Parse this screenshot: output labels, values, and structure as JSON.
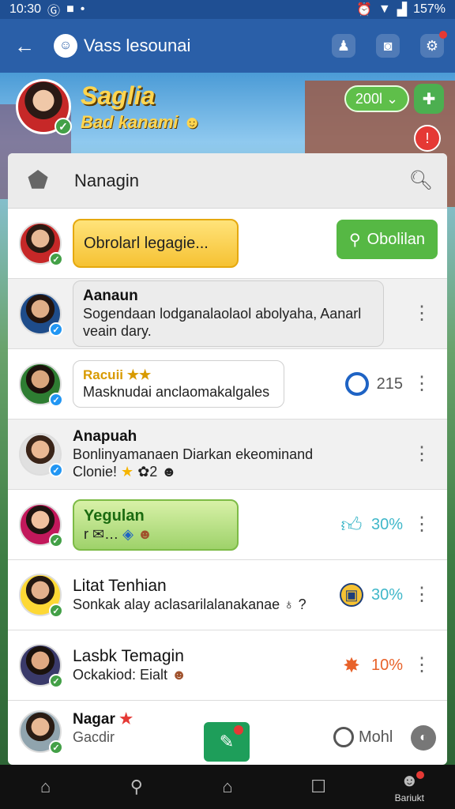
{
  "status": {
    "time": "10:30",
    "battery": "157%"
  },
  "appbar": {
    "title": "Vass lesounai",
    "back_icon": "arrow-left-icon",
    "actions": [
      "user-add-icon",
      "camera-icon",
      "settings-icon"
    ]
  },
  "profile": {
    "name_line1": "Saglia",
    "name_line2": "Bad kanami",
    "coins": "200l",
    "verified": true
  },
  "panel": {
    "title": "Nanagin",
    "search_icon": "search-icon"
  },
  "rows": [
    {
      "bubble": "Obrolarl legagie...",
      "button": "Obolilan"
    },
    {
      "name": "Aanaun",
      "message": "Sogendaan lodganalaolaol abolyaha, Aanarl veain dary."
    },
    {
      "name": "Racuii",
      "stars": "★★",
      "message": "Masknudai anclaomakalgales",
      "stat": "215"
    },
    {
      "name": "Anapuah",
      "message_line1": "Bonlinyamanaen Diarkan ekeominand",
      "message_line2": "Clonie!",
      "count": "2"
    },
    {
      "name": "Yegulan",
      "message": "r",
      "stat": "30%"
    },
    {
      "name": "Litat Tenhian",
      "message": "Sonkak alay aclasarilalanakanae ♁ ?",
      "stat": "30%"
    },
    {
      "name": "Lasbk Temagin",
      "message": "Ockakiod: Eialt",
      "stat": "10%"
    },
    {
      "name": "Nagar",
      "message": "Gacdir"
    }
  ],
  "bottom": {
    "online": "Mohl"
  },
  "nav": {
    "items": [
      "home-icon",
      "search-icon",
      "game-home-icon",
      "square-icon",
      "profile-icon"
    ],
    "profile_label": "Bariukt"
  },
  "colors": {
    "appbar": "#2a5fa8",
    "accent_green": "#56b844",
    "accent_yellow": "#f6c233",
    "alert_red": "#e53935"
  }
}
